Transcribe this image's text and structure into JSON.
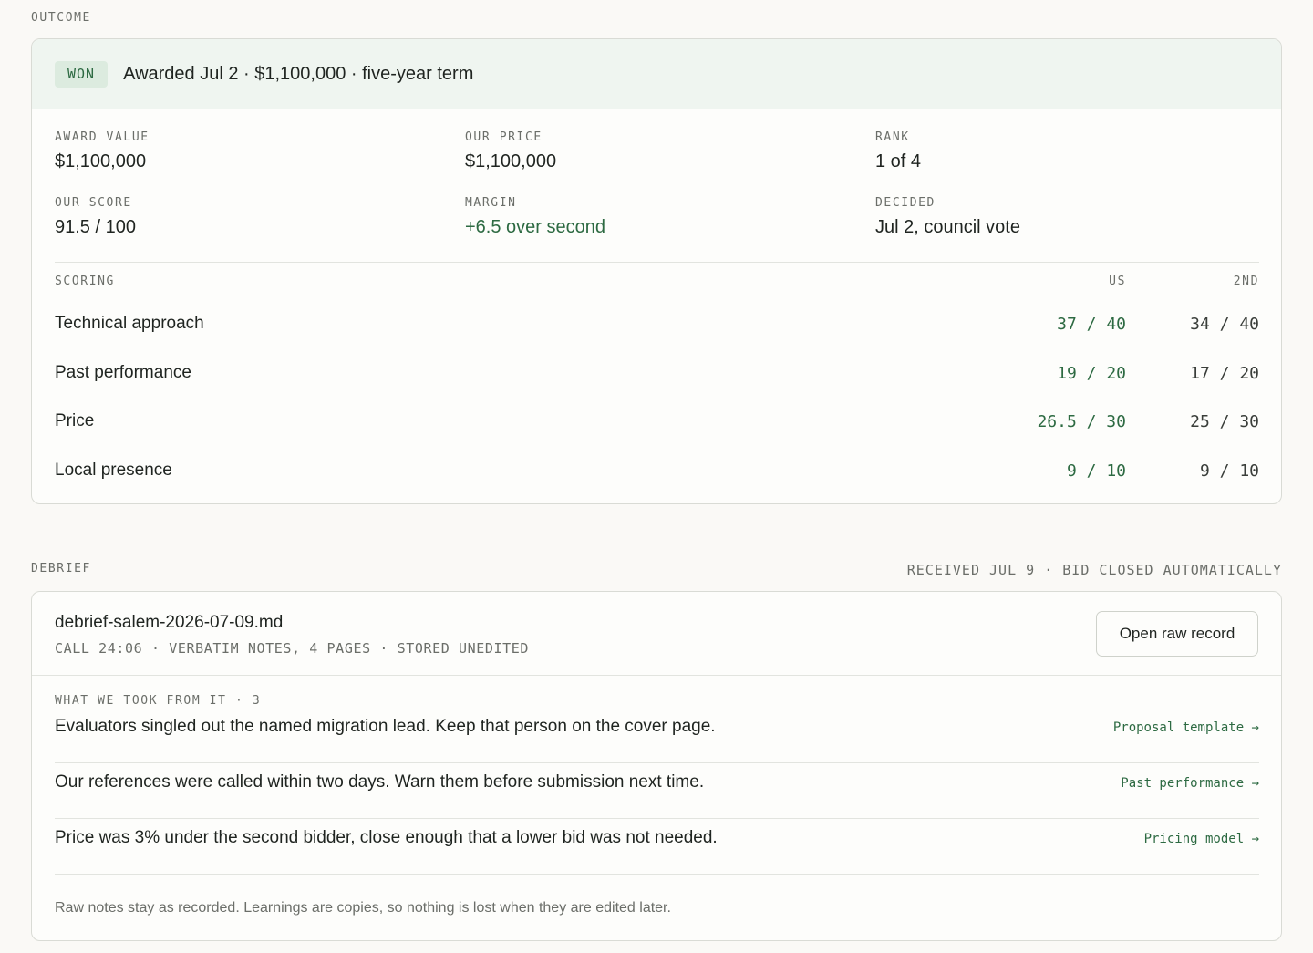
{
  "outcome": {
    "section_label": "OUTCOME",
    "badge": "WON",
    "headline": "Awarded Jul 2 · $1,100,000 · five-year term",
    "stats": [
      {
        "label": "AWARD VALUE",
        "value": "$1,100,000"
      },
      {
        "label": "OUR PRICE",
        "value": "$1,100,000"
      },
      {
        "label": "RANK",
        "value": "1 of 4"
      },
      {
        "label": "OUR SCORE",
        "value": "91.5 / 100"
      },
      {
        "label": "MARGIN",
        "value": "+6.5 over second"
      },
      {
        "label": "DECIDED",
        "value": "Jul 2, council vote"
      }
    ],
    "scoring": {
      "label": "SCORING",
      "col_us": "US",
      "col_second": "2ND",
      "rows": [
        {
          "criterion": "Technical approach",
          "us": "37 / 40",
          "second": "34 / 40"
        },
        {
          "criterion": "Past performance",
          "us": "19 / 20",
          "second": "17 / 20"
        },
        {
          "criterion": "Price",
          "us": "26.5 / 30",
          "second": "25 / 30"
        },
        {
          "criterion": "Local presence",
          "us": "9 / 10",
          "second": "9 / 10"
        }
      ]
    }
  },
  "debrief": {
    "section_label": "DEBRIEF",
    "meta": "RECEIVED JUL 9 · BID CLOSED AUTOMATICALLY",
    "file_name": "debrief-salem-2026-07-09.md",
    "file_meta": "CALL 24:06 · VERBATIM NOTES, 4 PAGES · STORED UNEDITED",
    "open_button": "Open raw record",
    "took_label": "WHAT WE TOOK FROM IT · 3",
    "learnings": [
      {
        "text": "Evaluators singled out the named migration lead. Keep that person on the cover page.",
        "link": "Proposal template →"
      },
      {
        "text": "Our references were called within two days. Warn them before submission next time.",
        "link": "Past performance →"
      },
      {
        "text": "Price was 3% under the second bidder, close enough that a lower bid was not needed.",
        "link": "Pricing model →"
      }
    ],
    "footnote": "Raw notes stay as recorded. Learnings are copies, so nothing is lost when they are edited later."
  },
  "colors": {
    "accent_green": "#2d6a42",
    "banner_bg": "#eff5f0",
    "page_bg": "#faf9f6"
  }
}
